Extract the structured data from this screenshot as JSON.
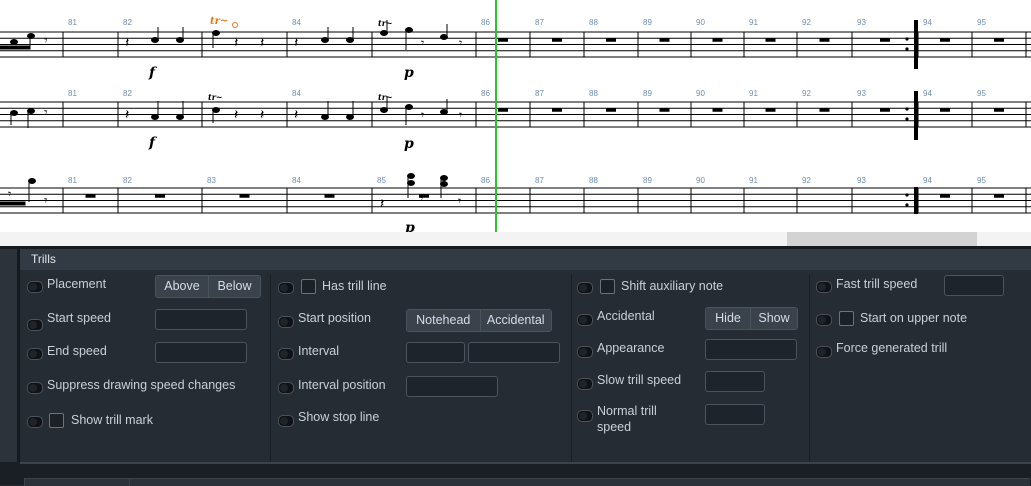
{
  "score": {
    "bar_numbers": [
      "81",
      "82",
      "83",
      "84",
      "85",
      "86",
      "87",
      "88",
      "89",
      "90",
      "91",
      "92",
      "93",
      "94",
      "95"
    ],
    "dynamics": {
      "forte": "f",
      "piano": "p"
    },
    "trill_symbol": "tr~"
  },
  "trills_panel": {
    "title": "Trills",
    "col1": {
      "placement": {
        "label": "Placement",
        "options": [
          "Above",
          "Below"
        ]
      },
      "start_speed": {
        "label": "Start speed",
        "value": ""
      },
      "end_speed": {
        "label": "End speed",
        "value": ""
      },
      "suppress": {
        "label": "Suppress drawing speed changes"
      },
      "show_trill_mark": {
        "label": "Show trill mark"
      }
    },
    "col2": {
      "has_trill_line": {
        "label": "Has trill line"
      },
      "start_position": {
        "label": "Start position",
        "options": [
          "Notehead",
          "Accidental"
        ]
      },
      "interval": {
        "label": "Interval",
        "value1": "",
        "value2": ""
      },
      "interval_position": {
        "label": "Interval position",
        "value": ""
      },
      "show_stop_line": {
        "label": "Show stop line"
      }
    },
    "col3": {
      "shift_auxiliary_note": {
        "label": "Shift auxiliary note"
      },
      "accidental": {
        "label": "Accidental",
        "options": [
          "Hide",
          "Show"
        ]
      },
      "appearance": {
        "label": "Appearance",
        "value": ""
      },
      "slow_trill_speed": {
        "label": "Slow trill speed",
        "value": ""
      },
      "normal_trill_speed": {
        "label_line1": "Normal trill",
        "label_line2": "speed",
        "value": ""
      }
    },
    "col4": {
      "fast_trill_speed": {
        "label": "Fast trill speed",
        "value": ""
      },
      "start_on_upper_note": {
        "label": "Start on upper note"
      },
      "force_generated_trill": {
        "label": "Force generated trill"
      }
    }
  },
  "colors": {
    "playhead": "#2ec02e",
    "panel_bg": "#252c34",
    "bar_number": "#6f8fb0",
    "selected_trill": "#e0781a"
  }
}
